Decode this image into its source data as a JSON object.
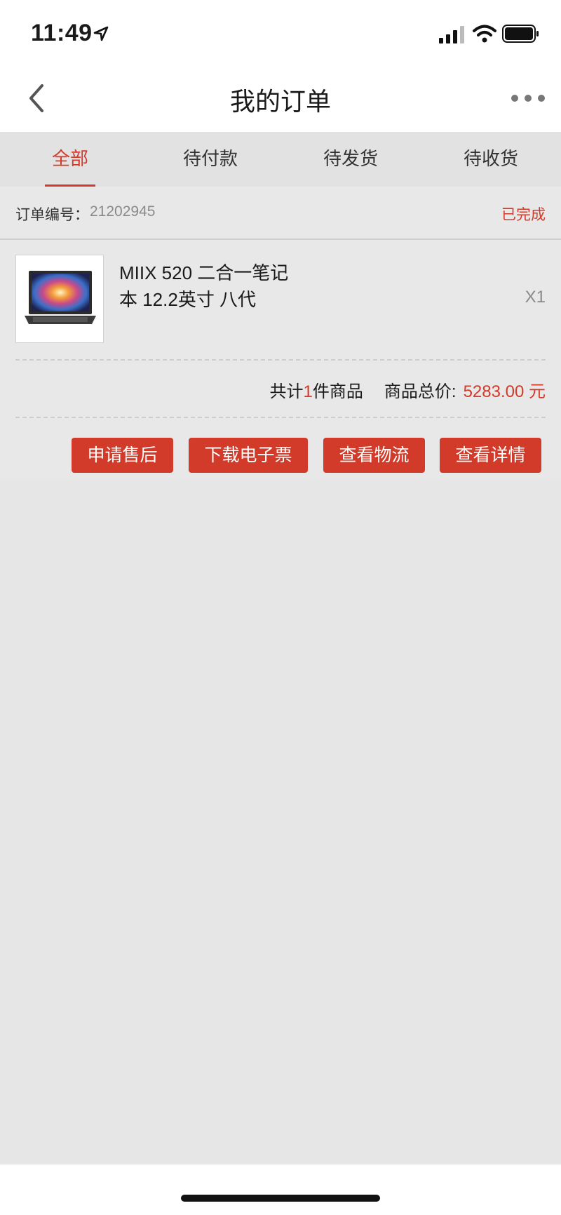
{
  "status_bar": {
    "time": "11:49"
  },
  "nav": {
    "title": "我的订单"
  },
  "tabs": [
    {
      "label": "全部"
    },
    {
      "label": "待付款"
    },
    {
      "label": "待发货"
    },
    {
      "label": "待收货"
    }
  ],
  "order": {
    "number_label": "订单编号：",
    "number_value": "21202945",
    "status": "已完成",
    "product": {
      "name": "MIIX 520 二合一笔记本 12.2英寸 八代",
      "quantity": "X1"
    },
    "summary": {
      "prefix": "共计",
      "count": "1",
      "suffix": "件商品",
      "total_label": "商品总价:",
      "total_value": "5283.00 元"
    },
    "actions": {
      "after_sale": "申请售后",
      "download_invoice": "下载电子票",
      "view_logistics": "查看物流",
      "view_details": "查看详情"
    }
  },
  "colors": {
    "accent": "#d23a2a",
    "background": "#e6e6e6"
  }
}
